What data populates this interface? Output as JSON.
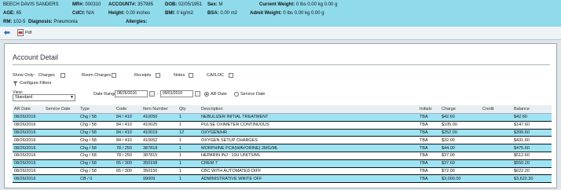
{
  "patient": {
    "name": "BEECH DAVIS SANDERS",
    "mr_label": "MR#:",
    "mr": "000310",
    "account_label": "ACCOUNT#:",
    "account": "357985",
    "dob_label": "DOB:",
    "dob": "02/05/1951",
    "sex_label": "Sex:",
    "sex": "M",
    "current_weight_label": "Current Weight:",
    "current_weight": "0 lbs 0.00 kg 0.00 g",
    "age_label": "AGE:",
    "age": "65",
    "cdt_label": "CdCt:",
    "cdt": "N/A",
    "height_label": "Height:",
    "height": "0.00 inches",
    "bmi_label": "BMI:",
    "bmi": "0 kg/m2",
    "bsa_label": "BSA:",
    "bsa": "0.00 m2",
    "admit_weight_label": "Admit Weight:",
    "admit_weight": "0 lbs 0.00 kg 0.00 g",
    "rm_label": "RM:",
    "rm": "102-5",
    "diagnosis_label": "Diagnosis:",
    "diagnosis": "Pneumonia",
    "allergies_label": "Allergies:",
    "allergies": ""
  },
  "toolbar": {
    "back_icon": "back-arrow-icon",
    "pdf_label": "Pdf"
  },
  "panel": {
    "title": "Account Detail",
    "show_only_label": "Show Only:",
    "filters": [
      "Charges",
      "Room Charges",
      "Receipts",
      "Notes",
      "CA/ILOC"
    ],
    "configure_filters_label": "Configure Filters",
    "view_label": "View:",
    "view_value": "Standard",
    "date_range_label": "Date Range:",
    "date_from": "08/26/2016",
    "date_to": "09/01/2016",
    "radio_ar_date": "AR Date",
    "radio_service_date": "Service Date"
  },
  "table": {
    "headers": [
      "AR Date",
      "Service Date",
      "Type",
      "Code",
      "Item Number",
      "Qty",
      "Description",
      "Initials",
      "Charge",
      "Credit",
      "Balance"
    ],
    "rows": [
      [
        "08/26/2016",
        "",
        "Chg / 58",
        "84 / 410",
        "410050",
        "1",
        "NEBULIZER INITIAL TREATMENT",
        "TBA",
        "$42.60",
        "",
        "$42.60"
      ],
      [
        "08/26/2016",
        "",
        "Chg / 58",
        "84 / 410",
        "410025",
        "1",
        "PULSE OXIMETER CONTINUOUS",
        "TBA",
        "$105.00",
        "",
        "$147.60"
      ],
      [
        "08/26/2016",
        "",
        "Chg / 58",
        "84 / 410",
        "410019",
        "12",
        "OXYGEN/HR",
        "TBA",
        "$252.00",
        "",
        "$399.60"
      ],
      [
        "08/26/2016",
        "",
        "Chg / 58",
        "84 / 410",
        "410052",
        "1",
        "OXYGEN SETUP CHARGES",
        "TBA",
        "$32.00",
        "",
        "$431.60"
      ],
      [
        "08/26/2016",
        "",
        "Chg / 58",
        "78 / 250",
        "387818",
        "1",
        "MORPHINE PCA(WAVORINE) 2MG/ML",
        "TBA",
        "$44.00",
        "",
        "$475.60"
      ],
      [
        "08/26/2016",
        "",
        "Chg / 58",
        "78 / 250",
        "387815",
        "1",
        "HEPARIN INJ : 10U UNITS/ML",
        "TBA",
        "$37.00",
        "",
        "$512.60"
      ],
      [
        "08/26/2016",
        "",
        "Chg / 58",
        "65 / 300",
        "350158",
        "1",
        "CREM 7",
        "TBA",
        "$37.60",
        "",
        "$550.20"
      ],
      [
        "08/26/2016",
        "",
        "Chg / 58",
        "65 / 300",
        "350150",
        "1",
        "CBC WITH AUTOMATED DIFF",
        "TBA",
        "$72.00",
        "",
        "$622.20"
      ],
      [
        "08/26/2016",
        "",
        "CB / 0",
        "",
        "99009",
        "1",
        "ADMINISTRATIVE WRITE OFF",
        "TBA",
        "$3,000.00",
        "",
        "$3,622.20"
      ]
    ]
  },
  "colors": {
    "banner": "#8fdbec",
    "highlight_row": "#9ee3f3"
  }
}
